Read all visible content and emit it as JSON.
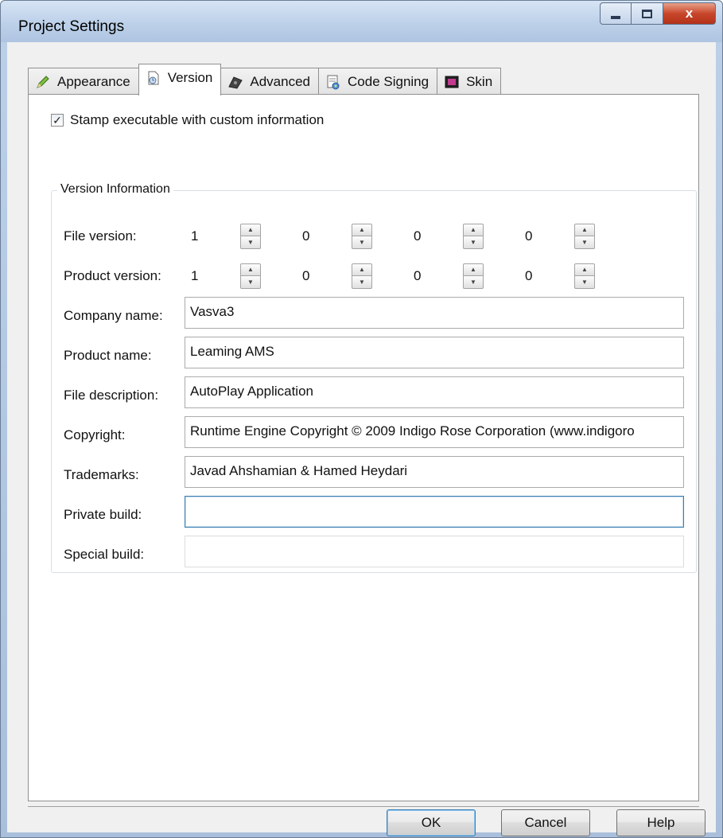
{
  "window": {
    "title": "Project Settings",
    "close_glyph": "x"
  },
  "tabs": [
    {
      "label": "Appearance",
      "icon": "pencil-icon"
    },
    {
      "label": "Version",
      "icon": "document-icon",
      "active": true
    },
    {
      "label": "Advanced",
      "icon": "gear-icon"
    },
    {
      "label": "Code Signing",
      "icon": "certificate-icon"
    },
    {
      "label": "Skin",
      "icon": "skin-icon"
    }
  ],
  "stamp": {
    "label": "Stamp executable with custom information",
    "checked": true,
    "check_glyph": "✓"
  },
  "version_info": {
    "group_label": "Version Information",
    "file_version": {
      "label": "File version:",
      "values": [
        "1",
        "0",
        "0",
        "0"
      ]
    },
    "product_version": {
      "label": "Product version:",
      "values": [
        "1",
        "0",
        "0",
        "0"
      ]
    },
    "company_name": {
      "label": "Company name:",
      "value": "Vasva3"
    },
    "product_name": {
      "label": "Product name:",
      "value": "Leaming AMS"
    },
    "file_description": {
      "label": "File description:",
      "value": "AutoPlay Application"
    },
    "copyright": {
      "label": "Copyright:",
      "value": "Runtime Engine Copyright © 2009 Indigo Rose Corporation (www.indigoro"
    },
    "trademarks": {
      "label": "Trademarks:",
      "value": "Javad Ahshamian & Hamed Heydari"
    },
    "private_build": {
      "label": "Private build:",
      "value": ""
    },
    "special_build": {
      "label": "Special build:",
      "value": ""
    }
  },
  "buttons": {
    "ok": "OK",
    "cancel": "Cancel",
    "help": "Help"
  },
  "spin_glyphs": {
    "up": "▲",
    "down": "▼"
  }
}
